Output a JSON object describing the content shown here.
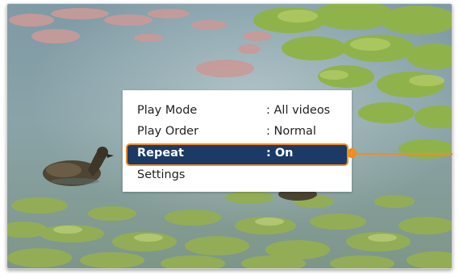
{
  "menu": {
    "items": [
      {
        "label": "Play Mode",
        "value": ": All videos"
      },
      {
        "label": "Play Order",
        "value": ": Normal"
      },
      {
        "label": "Repeat",
        "value": ": On"
      },
      {
        "label": "Settings",
        "value": ""
      }
    ],
    "selected_index": 2
  },
  "colors": {
    "selection": "#1b3a66",
    "highlight_border": "#f28c1e",
    "callout": "#f28c1e"
  }
}
